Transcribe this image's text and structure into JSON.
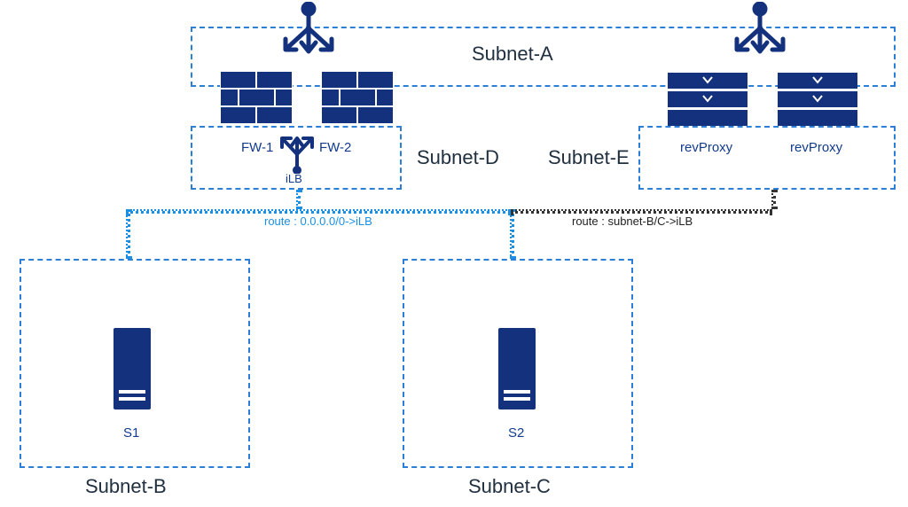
{
  "subnets": {
    "a": {
      "label": "Subnet-A"
    },
    "b": {
      "label": "Subnet-B"
    },
    "c": {
      "label": "Subnet-C"
    },
    "d": {
      "label": "Subnet-D"
    },
    "e": {
      "label": "Subnet-E"
    }
  },
  "firewalls": {
    "fw1": {
      "label": "FW-1"
    },
    "fw2": {
      "label": "FW-2"
    }
  },
  "ilb": {
    "label": "iLB"
  },
  "revproxy": {
    "left": {
      "label": "revProxy"
    },
    "right": {
      "label": "revProxy"
    }
  },
  "servers": {
    "s1": {
      "label": "S1"
    },
    "s2": {
      "label": "S2"
    }
  },
  "routes": {
    "left": {
      "label": "route : 0.0.0.0/0->iLB"
    },
    "right": {
      "label": "route : subnet-B/C->iLB"
    }
  }
}
